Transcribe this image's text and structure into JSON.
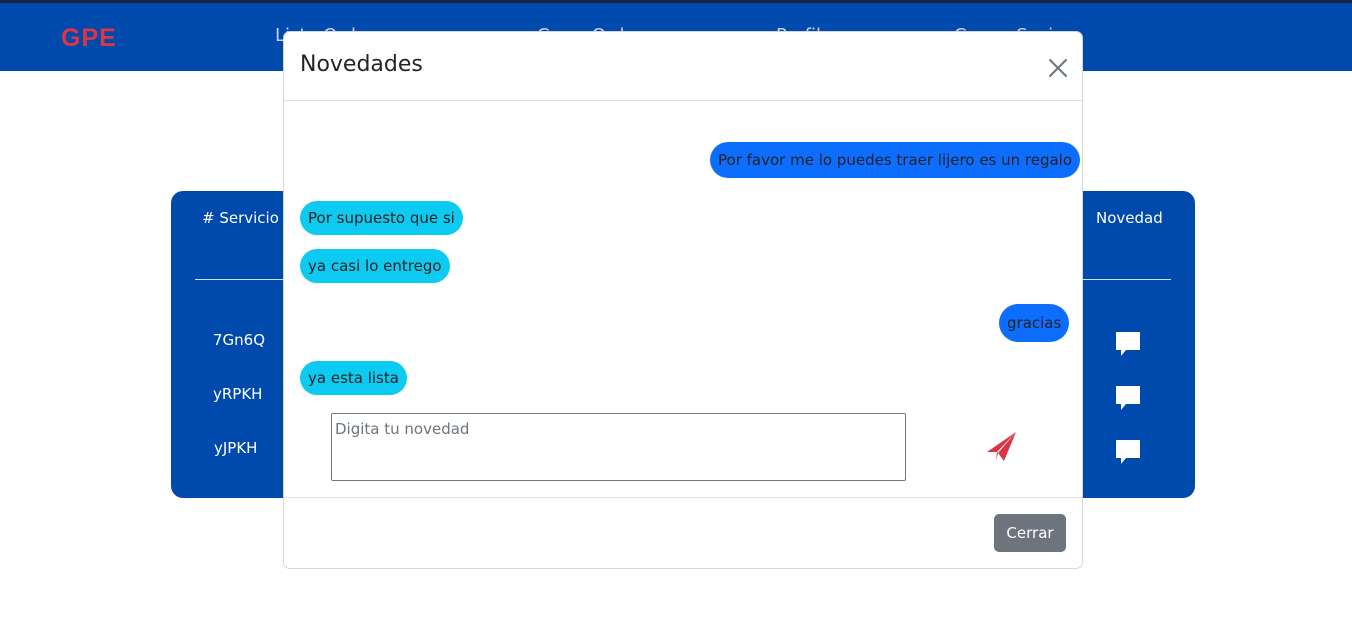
{
  "navbar": {
    "brand": "GPE",
    "links": [
      "Lista Ordenes",
      "Crear Orden",
      "Perfil",
      "Cerrar Sesion"
    ]
  },
  "table": {
    "headers": {
      "servicio": "# Servicio",
      "novedad": "Novedad"
    },
    "rows": [
      {
        "servicio": "7Gn6Q"
      },
      {
        "servicio": "yRPKH"
      },
      {
        "servicio": "yJPKH"
      }
    ]
  },
  "modal": {
    "title": "Novedades",
    "messages": [
      {
        "from": "sent",
        "text": "Por favor me lo puedes traer lijero es un regalo"
      },
      {
        "from": "received",
        "text": "Por supuesto que si"
      },
      {
        "from": "received",
        "text": "ya casi lo entrego"
      },
      {
        "from": "sent",
        "text": "gracias"
      },
      {
        "from": "received",
        "text": "ya esta lista"
      }
    ],
    "input": {
      "value": "",
      "placeholder": "Digita tu novedad"
    },
    "close_label": "Cerrar"
  },
  "icons": {
    "close": "close-icon",
    "send": "paper-plane-icon",
    "chat": "chat-bubble-icon"
  },
  "colors": {
    "navbar": "#004aad",
    "brand": "#dc3545",
    "sent_bubble": "#0d6efd",
    "received_bubble": "#0dcaf0",
    "send_icon": "#dc3545",
    "secondary_button": "#6c757d"
  }
}
